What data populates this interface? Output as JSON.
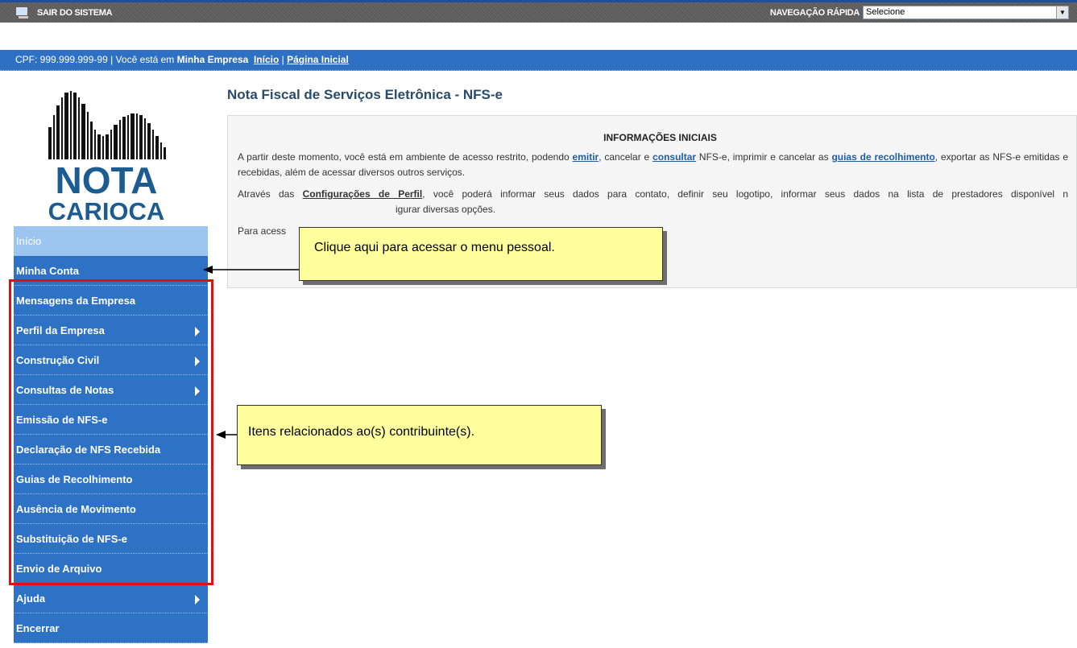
{
  "topbar": {
    "exit_label": "SAIR DO SISTEMA",
    "quicknav_label": "NAVEGAÇÃO RÁPIDA",
    "quicknav_value": "Selecione"
  },
  "breadcrumb": {
    "cpf_text": "CPF: 999.999.999-99",
    "sep1": " | ",
    "location_prefix": "Você está em ",
    "location_company": "Minha Empresa",
    "link_inicio": "Início",
    "sep2": " | ",
    "link_pagina_inicial": "Página Inicial"
  },
  "logo": {
    "line1": "NOTA",
    "line2": "CARIOCA"
  },
  "sidebar": {
    "items": [
      {
        "label": "Início"
      },
      {
        "label": "Minha Conta"
      },
      {
        "label": "Mensagens da Empresa"
      },
      {
        "label": "Perfil da Empresa"
      },
      {
        "label": "Construção Civil"
      },
      {
        "label": "Consultas de Notas"
      },
      {
        "label": "Emissão de NFS-e"
      },
      {
        "label": "Declaração de NFS Recebida"
      },
      {
        "label": "Guias de Recolhimento"
      },
      {
        "label": "Ausência de Movimento"
      },
      {
        "label": "Substituição de NFS-e"
      },
      {
        "label": "Envio de Arquivo"
      },
      {
        "label": "Ajuda"
      },
      {
        "label": "Encerrar"
      }
    ]
  },
  "main": {
    "title": "Nota Fiscal de Serviços Eletrônica - NFS-e",
    "info_heading": "INFORMAÇÕES INICIAIS",
    "p1_a": "A partir deste momento, você está em ambiente de acesso restrito, podendo ",
    "p1_link_emitir": "emitir",
    "p1_b": ", cancelar e ",
    "p1_link_consultar": "consultar",
    "p1_c": " NFS-e, imprimir e cancelar as ",
    "p1_link_guias": "guias de recolhimento",
    "p1_d": ", exportar as NFS-e emitidas e recebidas, além de acessar diversos outros serviços.",
    "p2_a": "Através das ",
    "p2_bold": "Configurações de Perfil",
    "p2_b": ", você poderá informar seus dados para contato, definir seu logotipo, informar seus dados na lista de prestadores disponível n",
    "p2_c": "igurar diversas opções.",
    "p3": "Para acess"
  },
  "callouts": {
    "menu_pessoal": "Clique aqui para acessar o menu pessoal.",
    "contribuintes": "Itens relacionados ao(s) contribuinte(s)."
  },
  "colors": {
    "accent_blue": "#2e72c5",
    "active_item": "#9cc6f0",
    "highlight_red": "#e01010",
    "callout_yellow": "#ffff9e"
  }
}
